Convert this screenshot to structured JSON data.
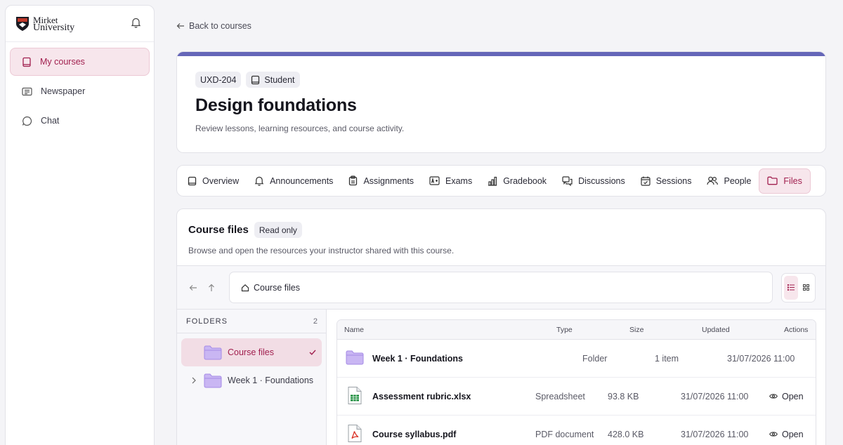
{
  "brand": {
    "line1": "Mirket",
    "line2": "University"
  },
  "sidebar": {
    "items": [
      {
        "label": "My courses",
        "icon": "book-icon",
        "active": true
      },
      {
        "label": "Newspaper",
        "icon": "newspaper-icon"
      },
      {
        "label": "Chat",
        "icon": "chat-bubble-icon"
      }
    ]
  },
  "back_link": "Back to courses",
  "course": {
    "code": "UXD-204",
    "role": "Student",
    "title": "Design foundations",
    "subtitle": "Review lessons, learning resources, and course activity.",
    "accent": "#6566b8"
  },
  "tabs": [
    {
      "label": "Overview",
      "icon": "book-icon"
    },
    {
      "label": "Announcements",
      "icon": "bell-icon"
    },
    {
      "label": "Assignments",
      "icon": "clipboard-icon"
    },
    {
      "label": "Exams",
      "icon": "exam-icon"
    },
    {
      "label": "Gradebook",
      "icon": "bar-chart-icon"
    },
    {
      "label": "Discussions",
      "icon": "discussion-icon"
    },
    {
      "label": "Sessions",
      "icon": "calendar-check-icon"
    },
    {
      "label": "People",
      "icon": "people-icon"
    },
    {
      "label": "Files",
      "icon": "folder-icon",
      "active": true
    }
  ],
  "files": {
    "title": "Course files",
    "badge": "Read only",
    "subtitle": "Browse and open the resources your instructor shared with this course.",
    "breadcrumb": "Course files",
    "folders_header": "FOLDERS",
    "folders_count": "2",
    "tree": [
      {
        "label": "Course files",
        "selected": true
      },
      {
        "label": "Week 1 · Foundations",
        "expandable": true
      }
    ],
    "columns": {
      "name": "Name",
      "type": "Type",
      "size": "Size",
      "updated": "Updated",
      "actions": "Actions"
    },
    "rows": [
      {
        "name": "Week 1 · Foundations",
        "type": "Folder",
        "size": "1 item",
        "updated": "31/07/2026 11:00",
        "icon": "folder-icon",
        "action": ""
      },
      {
        "name": "Assessment rubric.xlsx",
        "type": "Spreadsheet",
        "size": "93.8 KB",
        "updated": "31/07/2026 11:00",
        "icon": "spreadsheet-file-icon",
        "action": "Open"
      },
      {
        "name": "Course syllabus.pdf",
        "type": "PDF document",
        "size": "428.0 KB",
        "updated": "31/07/2026 11:00",
        "icon": "pdf-file-icon",
        "action": "Open"
      }
    ]
  },
  "colors": {
    "brand_accent": "#a1204f",
    "active_bg": "#f7e6ec",
    "folder": "#b9a3ef",
    "spreadsheet": "#1e8e3e",
    "pdf": "#d93025"
  }
}
